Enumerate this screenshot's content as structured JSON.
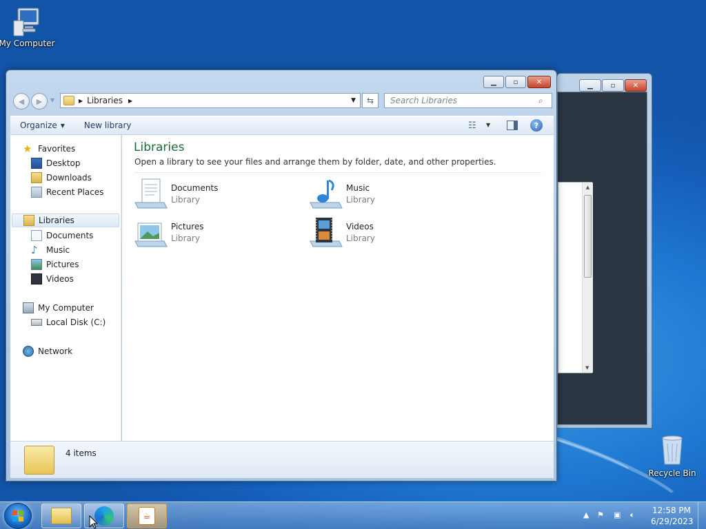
{
  "desktop": {
    "icons": [
      {
        "label": "My Computer",
        "icon": "computer-icon"
      },
      {
        "label": "Recycle Bin",
        "icon": "recycle-bin-icon"
      }
    ]
  },
  "window": {
    "address": {
      "segments": [
        "Libraries"
      ]
    },
    "search_placeholder": "Search Libraries",
    "toolbar": {
      "organize": "Organize",
      "new_library": "New library"
    },
    "nav": {
      "favorites": "Favorites",
      "favorites_items": [
        "Desktop",
        "Downloads",
        "Recent Places"
      ],
      "libraries": "Libraries",
      "libraries_items": [
        "Documents",
        "Music",
        "Pictures",
        "Videos"
      ],
      "computer": "My Computer",
      "computer_items": [
        "Local Disk (C:)"
      ],
      "network": "Network"
    },
    "content": {
      "title": "Libraries",
      "subtitle": "Open a library to see your files and arrange them by folder, date, and other properties.",
      "libraries": [
        {
          "name": "Documents",
          "type": "Library"
        },
        {
          "name": "Music",
          "type": "Library"
        },
        {
          "name": "Pictures",
          "type": "Library"
        },
        {
          "name": "Videos",
          "type": "Library"
        }
      ]
    },
    "details": {
      "item_count": "4 items"
    }
  },
  "taskbar": {
    "apps": [
      "Windows Explorer",
      "Microsoft Edge",
      "Java"
    ],
    "clock": {
      "time": "12:58 PM",
      "date": "6/29/2023"
    }
  },
  "colors": {
    "accent_title": "#1c6b37",
    "desktop_bg": "#1a6fc9"
  }
}
